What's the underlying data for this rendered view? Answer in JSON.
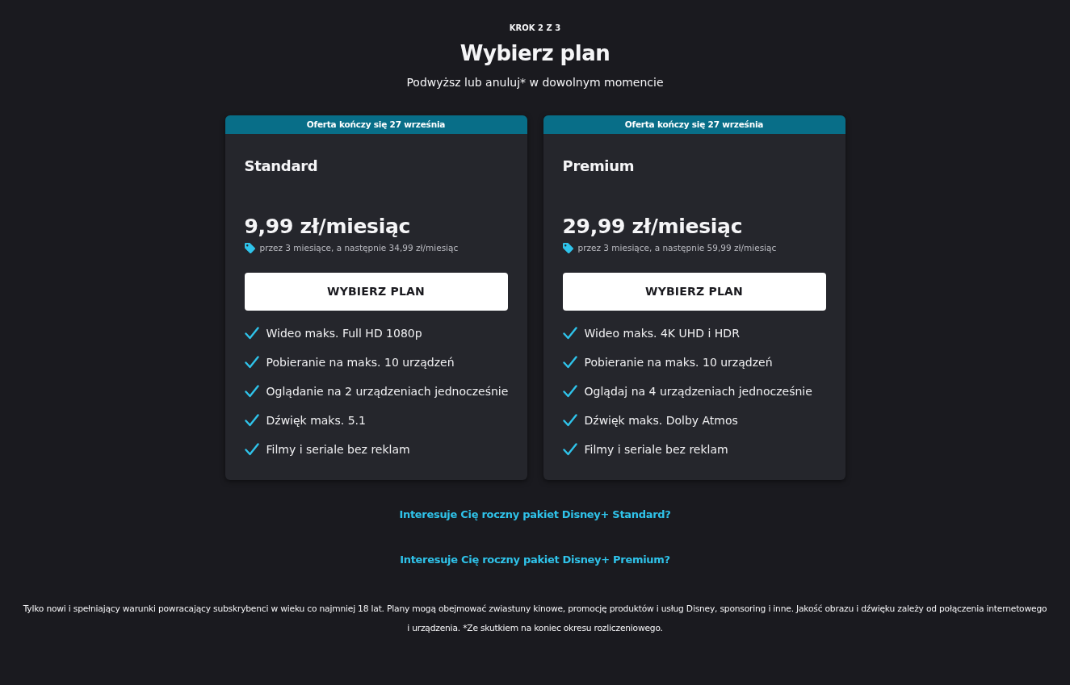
{
  "step": "KROK 2 Z 3",
  "title": "Wybierz plan",
  "subtitle": "Podwyższ lub anuluj* w dowolnym momencie",
  "plans": [
    {
      "banner": "Oferta kończy się 27 września",
      "name": "Standard",
      "price": "9,99 zł/miesiąc",
      "promo_note": "przez 3 miesiące, a następnie 34,99 zł/miesiąc",
      "button": "WYBIERZ PLAN",
      "features": [
        "Wideo maks. Full HD 1080p",
        "Pobieranie na maks. 10 urządzeń",
        "Oglądanie na 2 urządzeniach jednocześnie",
        "Dźwięk maks. 5.1",
        "Filmy i seriale bez reklam"
      ]
    },
    {
      "banner": "Oferta kończy się 27 września",
      "name": "Premium",
      "price": "29,99 zł/miesiąc",
      "promo_note": "przez 3 miesiące, a następnie 59,99 zł/miesiąc",
      "button": "WYBIERZ PLAN",
      "features": [
        "Wideo maks. 4K UHD i HDR",
        "Pobieranie na maks. 10 urządzeń",
        "Oglądaj na 4 urządzeniach jednocześnie",
        "Dźwięk maks. Dolby Atmos",
        "Filmy i seriale bez reklam"
      ]
    }
  ],
  "links": [
    "Interesuje Cię roczny pakiet Disney+ Standard?",
    "Interesuje Cię roczny pakiet Disney+ Premium?"
  ],
  "footnote": "Tylko nowi i spełniający warunki powracający subskrybenci w wieku co najmniej 18 lat. Plany mogą obejmować zwiastuny kinowe, promocję produktów i usług Disney, sponsoring i inne. Jakość obrazu i dźwięku zależy od połączenia internetowego i urządzenia. *Ze skutkiem na koniec okresu rozliczeniowego."
}
